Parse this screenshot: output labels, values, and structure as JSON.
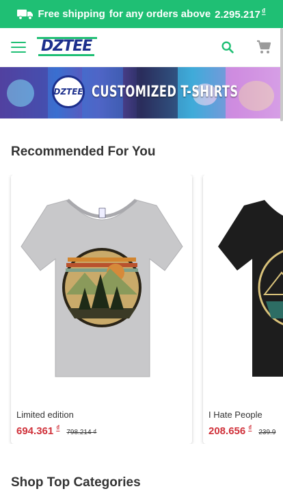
{
  "topbar": {
    "icon": "truck-icon",
    "lead": "Free shipping",
    "rest": "for any orders above",
    "amount": "2.295.217",
    "currency": "₫"
  },
  "header": {
    "logo": "DZTEE",
    "menu_icon": "menu-icon",
    "search_icon": "search-icon",
    "cart_icon": "cart-icon"
  },
  "banner": {
    "badge": "DZTEE",
    "title": "CUSTOMIZED T-SHIRTS"
  },
  "recommended": {
    "title": "Recommended For You",
    "products": [
      {
        "name": "Limited edition",
        "price": "694.361",
        "currency": "₫",
        "old_price": "798.214 ₫"
      },
      {
        "name": "I Hate People",
        "price": "208.656",
        "currency": "₫",
        "old_price": "239.9"
      }
    ]
  },
  "categories": {
    "title": "Shop Top Categories"
  },
  "colors": {
    "accent": "#1fbf74",
    "brand": "#1c2f8c",
    "price": "#d0313a"
  }
}
